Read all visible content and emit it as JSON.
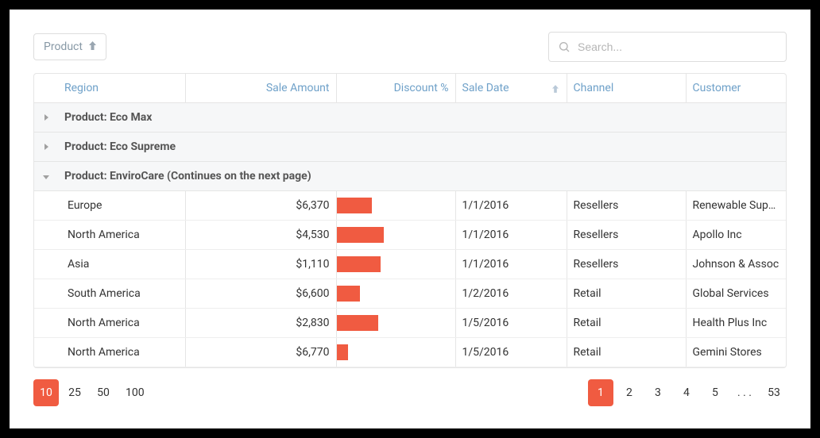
{
  "group_panel": {
    "label": "Product"
  },
  "search": {
    "placeholder": "Search..."
  },
  "columns": {
    "region": "Region",
    "sale_amount": "Sale Amount",
    "discount_pct": "Discount %",
    "sale_date": "Sale Date",
    "channel": "Channel",
    "customer": "Customer"
  },
  "groups": [
    {
      "label": "Product: Eco Max",
      "expanded": false
    },
    {
      "label": "Product: Eco Supreme",
      "expanded": false
    },
    {
      "label": "Product: EnviroCare (Continues on the next page)",
      "expanded": true
    }
  ],
  "rows": [
    {
      "region": "Europe",
      "sale_amount": "$6,370",
      "discount_fraction": 0.3,
      "sale_date": "1/1/2016",
      "channel": "Resellers",
      "customer": "Renewable Supplies"
    },
    {
      "region": "North America",
      "sale_amount": "$4,530",
      "discount_fraction": 0.4,
      "sale_date": "1/1/2016",
      "channel": "Resellers",
      "customer": "Apollo Inc"
    },
    {
      "region": "Asia",
      "sale_amount": "$1,110",
      "discount_fraction": 0.37,
      "sale_date": "1/1/2016",
      "channel": "Resellers",
      "customer": "Johnson & Assoc"
    },
    {
      "region": "South America",
      "sale_amount": "$6,600",
      "discount_fraction": 0.2,
      "sale_date": "1/2/2016",
      "channel": "Retail",
      "customer": "Global Services"
    },
    {
      "region": "North America",
      "sale_amount": "$2,830",
      "discount_fraction": 0.35,
      "sale_date": "1/5/2016",
      "channel": "Retail",
      "customer": "Health Plus Inc"
    },
    {
      "region": "North America",
      "sale_amount": "$6,770",
      "discount_fraction": 0.1,
      "sale_date": "1/5/2016",
      "channel": "Retail",
      "customer": "Gemini Stores"
    }
  ],
  "page_sizes": [
    "10",
    "25",
    "50",
    "100"
  ],
  "active_page_size": "10",
  "pages": [
    "1",
    "2",
    "3",
    "4",
    "5",
    ". . .",
    "53"
  ],
  "active_page": "1",
  "bar_color": "#f05b41"
}
